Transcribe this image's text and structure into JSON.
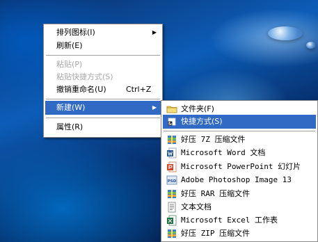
{
  "context_menu": {
    "items": [
      {
        "label": "排列图标(I)",
        "has_submenu": true,
        "disabled": false
      },
      {
        "label": "刷新(E)",
        "has_submenu": false,
        "disabled": false
      },
      {
        "label": "粘贴(P)",
        "has_submenu": false,
        "disabled": true
      },
      {
        "label": "粘贴快捷方式(S)",
        "has_submenu": false,
        "disabled": true
      },
      {
        "label": "撤销重命名(U)",
        "shortcut": "Ctrl+Z",
        "has_submenu": false,
        "disabled": false
      },
      {
        "label": "新建(W)",
        "has_submenu": true,
        "disabled": false,
        "highlighted": true
      },
      {
        "label": "属性(R)",
        "has_submenu": false,
        "disabled": false
      }
    ],
    "submenu_arrow": "▶"
  },
  "new_submenu": {
    "items": [
      {
        "label": "文件夹(F)",
        "icon": "folder-icon"
      },
      {
        "label": "快捷方式(S)",
        "icon": "shortcut-icon",
        "highlighted": true
      },
      {
        "label": "好压 7Z 压缩文件",
        "icon": "archive-icon"
      },
      {
        "label": "Microsoft Word 文档",
        "icon": "word-icon"
      },
      {
        "label": "Microsoft PowerPoint 幻灯片",
        "icon": "powerpoint-icon"
      },
      {
        "label": "Adobe Photoshop Image 13",
        "icon": "photoshop-icon",
        "icon_text": "PSD"
      },
      {
        "label": "好压 RAR 压缩文件",
        "icon": "archive-icon"
      },
      {
        "label": "文本文档",
        "icon": "text-document-icon"
      },
      {
        "label": "Microsoft Excel 工作表",
        "icon": "excel-icon"
      },
      {
        "label": "好压 ZIP 压缩文件",
        "icon": "archive-icon"
      }
    ]
  },
  "colors": {
    "highlight": "#316ac5",
    "disabled_text": "#a8a8a8",
    "desktop": "#0c5db8"
  }
}
